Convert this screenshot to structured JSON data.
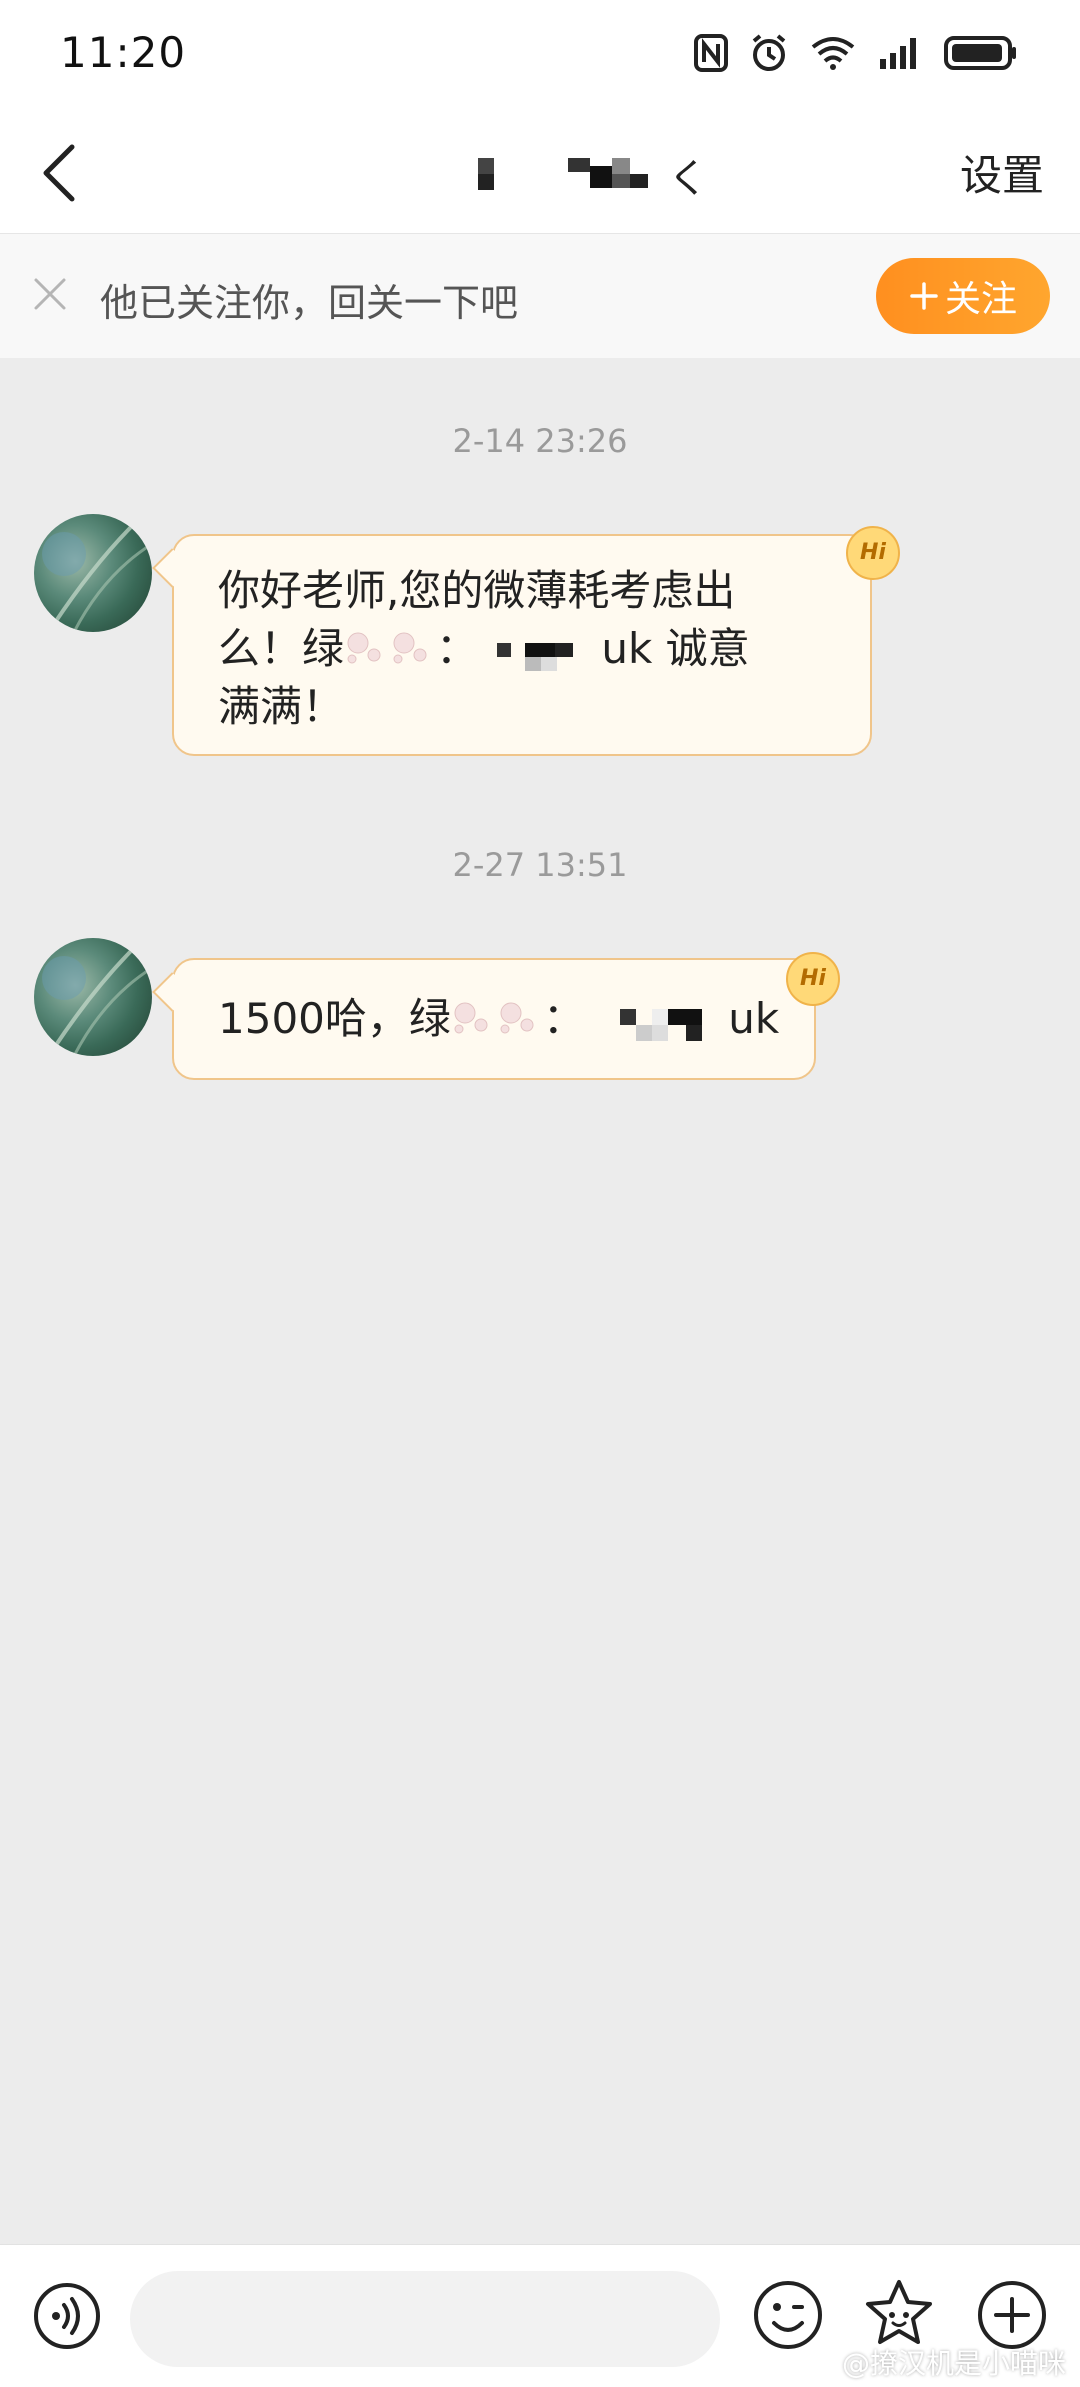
{
  "status_bar": {
    "time": "11:20",
    "icons": [
      "nfc-icon",
      "alarm-icon",
      "wifi-icon",
      "signal-icon",
      "battery-icon"
    ]
  },
  "nav": {
    "back_icon": "chevron-left-icon",
    "title_visible_suffix": "く",
    "settings_label": "设置"
  },
  "follow_banner": {
    "text": "他已关注你，回关一下吧",
    "button_label": "关注",
    "button_icon": "plus-icon",
    "accent_color": "#ff9a24"
  },
  "messages": [
    {
      "timestamp": "2-14 23:26",
      "lines": [
        "你好老师,您的微薄耗考虑出",
        "么！绿",
        "：",
        "uk  诚意",
        "满满！"
      ],
      "line1": "你好老师,您的微薄耗考虑出",
      "line2_prefix": "么！绿",
      "line2_colon": "：",
      "line2_suffix": "uk  诚意",
      "line3": "满满！",
      "badge": "Hi"
    },
    {
      "timestamp": "2-27 13:51",
      "text_prefix": "1500哈，绿",
      "text_colon": "：",
      "text_suffix": "uk",
      "badge": "Hi"
    }
  ],
  "bottom_bar": {
    "input_value": "",
    "icons": [
      "voice-icon",
      "emoji-icon",
      "star-face-icon",
      "plus-circle-icon"
    ]
  },
  "watermark": "@撩汉机是小喵咪"
}
